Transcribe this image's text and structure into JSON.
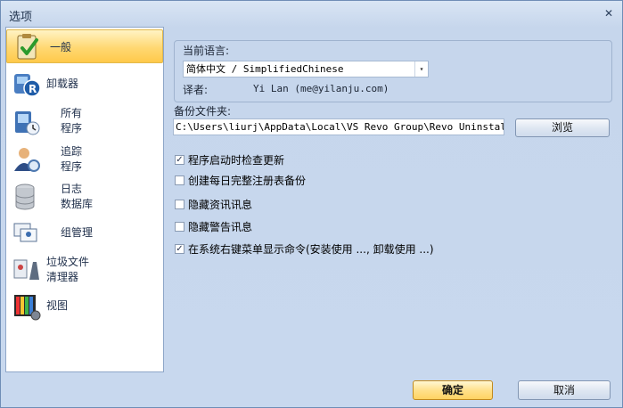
{
  "window": {
    "title": "选项",
    "close_glyph": "✕"
  },
  "sidebar": {
    "items": [
      {
        "id": "general",
        "label": "一般",
        "icon": "clipboard-check-icon",
        "selected": true
      },
      {
        "id": "uninstaller",
        "label": "卸载器",
        "icon": "revo-uninstaller-icon"
      },
      {
        "id": "installed-programs",
        "label": "所有\n程序",
        "icon": "programs-icon"
      },
      {
        "id": "traced-programs",
        "label": "追踪\n程序",
        "icon": "trace-user-icon"
      },
      {
        "id": "log-database",
        "label": "日志\n数据库",
        "icon": "database-icon"
      },
      {
        "id": "group-management",
        "label": "组管理",
        "icon": "groups-icon"
      },
      {
        "id": "junk-cleaner",
        "label": "垃圾文件\n清理器",
        "icon": "junk-cleaner-icon"
      },
      {
        "id": "view",
        "label": "视图",
        "icon": "view-colors-icon"
      }
    ]
  },
  "language": {
    "group_label": "当前语言:",
    "selected": "简体中文 / SimplifiedChinese",
    "translator_label": "译者:",
    "translator_value": "Yi Lan (me@yilanju.com)"
  },
  "backup": {
    "label": "备份文件夹:",
    "path": "C:\\Users\\liurj\\AppData\\Local\\VS Revo Group\\Revo Uninstaller Pr",
    "browse_label": "浏览"
  },
  "options": [
    {
      "label": "程序启动时检查更新",
      "checked": true
    },
    {
      "label": "创建每日完整注册表备份",
      "checked": false
    },
    {
      "label": "隐藏资讯讯息",
      "checked": false
    },
    {
      "label": "隐藏警告讯息",
      "checked": false
    },
    {
      "label": "在系统右键菜单显示命令(安装使用 ..., 卸载使用 ...)",
      "checked": true
    }
  ],
  "footer": {
    "ok_label": "确定",
    "cancel_label": "取消"
  },
  "colors": {
    "accent": "#ffd363",
    "frame": "#c8d8ee",
    "selected_nav": "#ffd872"
  }
}
